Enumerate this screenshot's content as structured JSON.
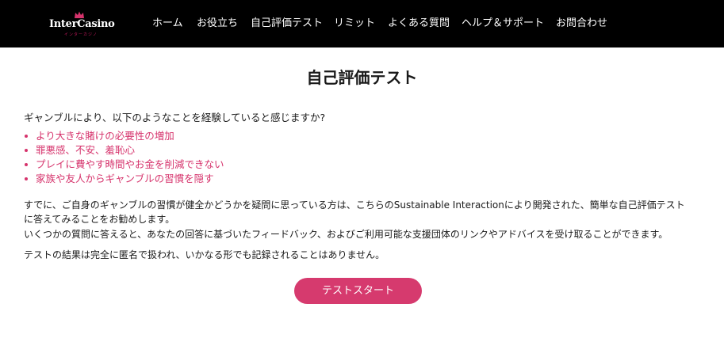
{
  "header": {
    "logo": {
      "text": "InterCasino",
      "sub": "インターカジノ"
    },
    "nav": [
      {
        "label": "ホーム"
      },
      {
        "label": "お役立ち"
      },
      {
        "label": "自己評価テスト"
      },
      {
        "label": "リミット"
      },
      {
        "label": "よくある質問"
      },
      {
        "label": "ヘルプ＆サポート"
      },
      {
        "label": "お問合わせ"
      }
    ]
  },
  "main": {
    "title": "自己評価テスト",
    "question": "ギャンブルにより、以下のようなことを経験していると感じますか?",
    "bullets": [
      "より大きな賭けの必要性の増加",
      "罪悪感、不安、羞恥心",
      "プレイに費やす時間やお金を削減できない",
      "家族や友人からギャンブルの習慣を隠す"
    ],
    "paragraph1_line1": "すでに、ご自身のギャンブルの習慣が健全かどうかを疑問に思っている方は、こちらのSustainable Interactionにより開発された、簡単な自己評価テスト",
    "paragraph1_line2": "に答えてみることをお勧めします。",
    "paragraph2": "いくつかの質問に答えると、あなたの回答に基づいたフィードバック、およびご利用可能な支援団体のリンクやアドバイスを受け取ることができます。",
    "paragraph3": "テストの結果は完全に匿名で扱われ、いかなる形でも記録されることはありません。",
    "start_button": "テストスタート"
  },
  "colors": {
    "header_bg": "#000000",
    "accent": "#d63a6e",
    "bullet_text": "#d6336c"
  },
  "icons": [
    "crown-icon"
  ]
}
